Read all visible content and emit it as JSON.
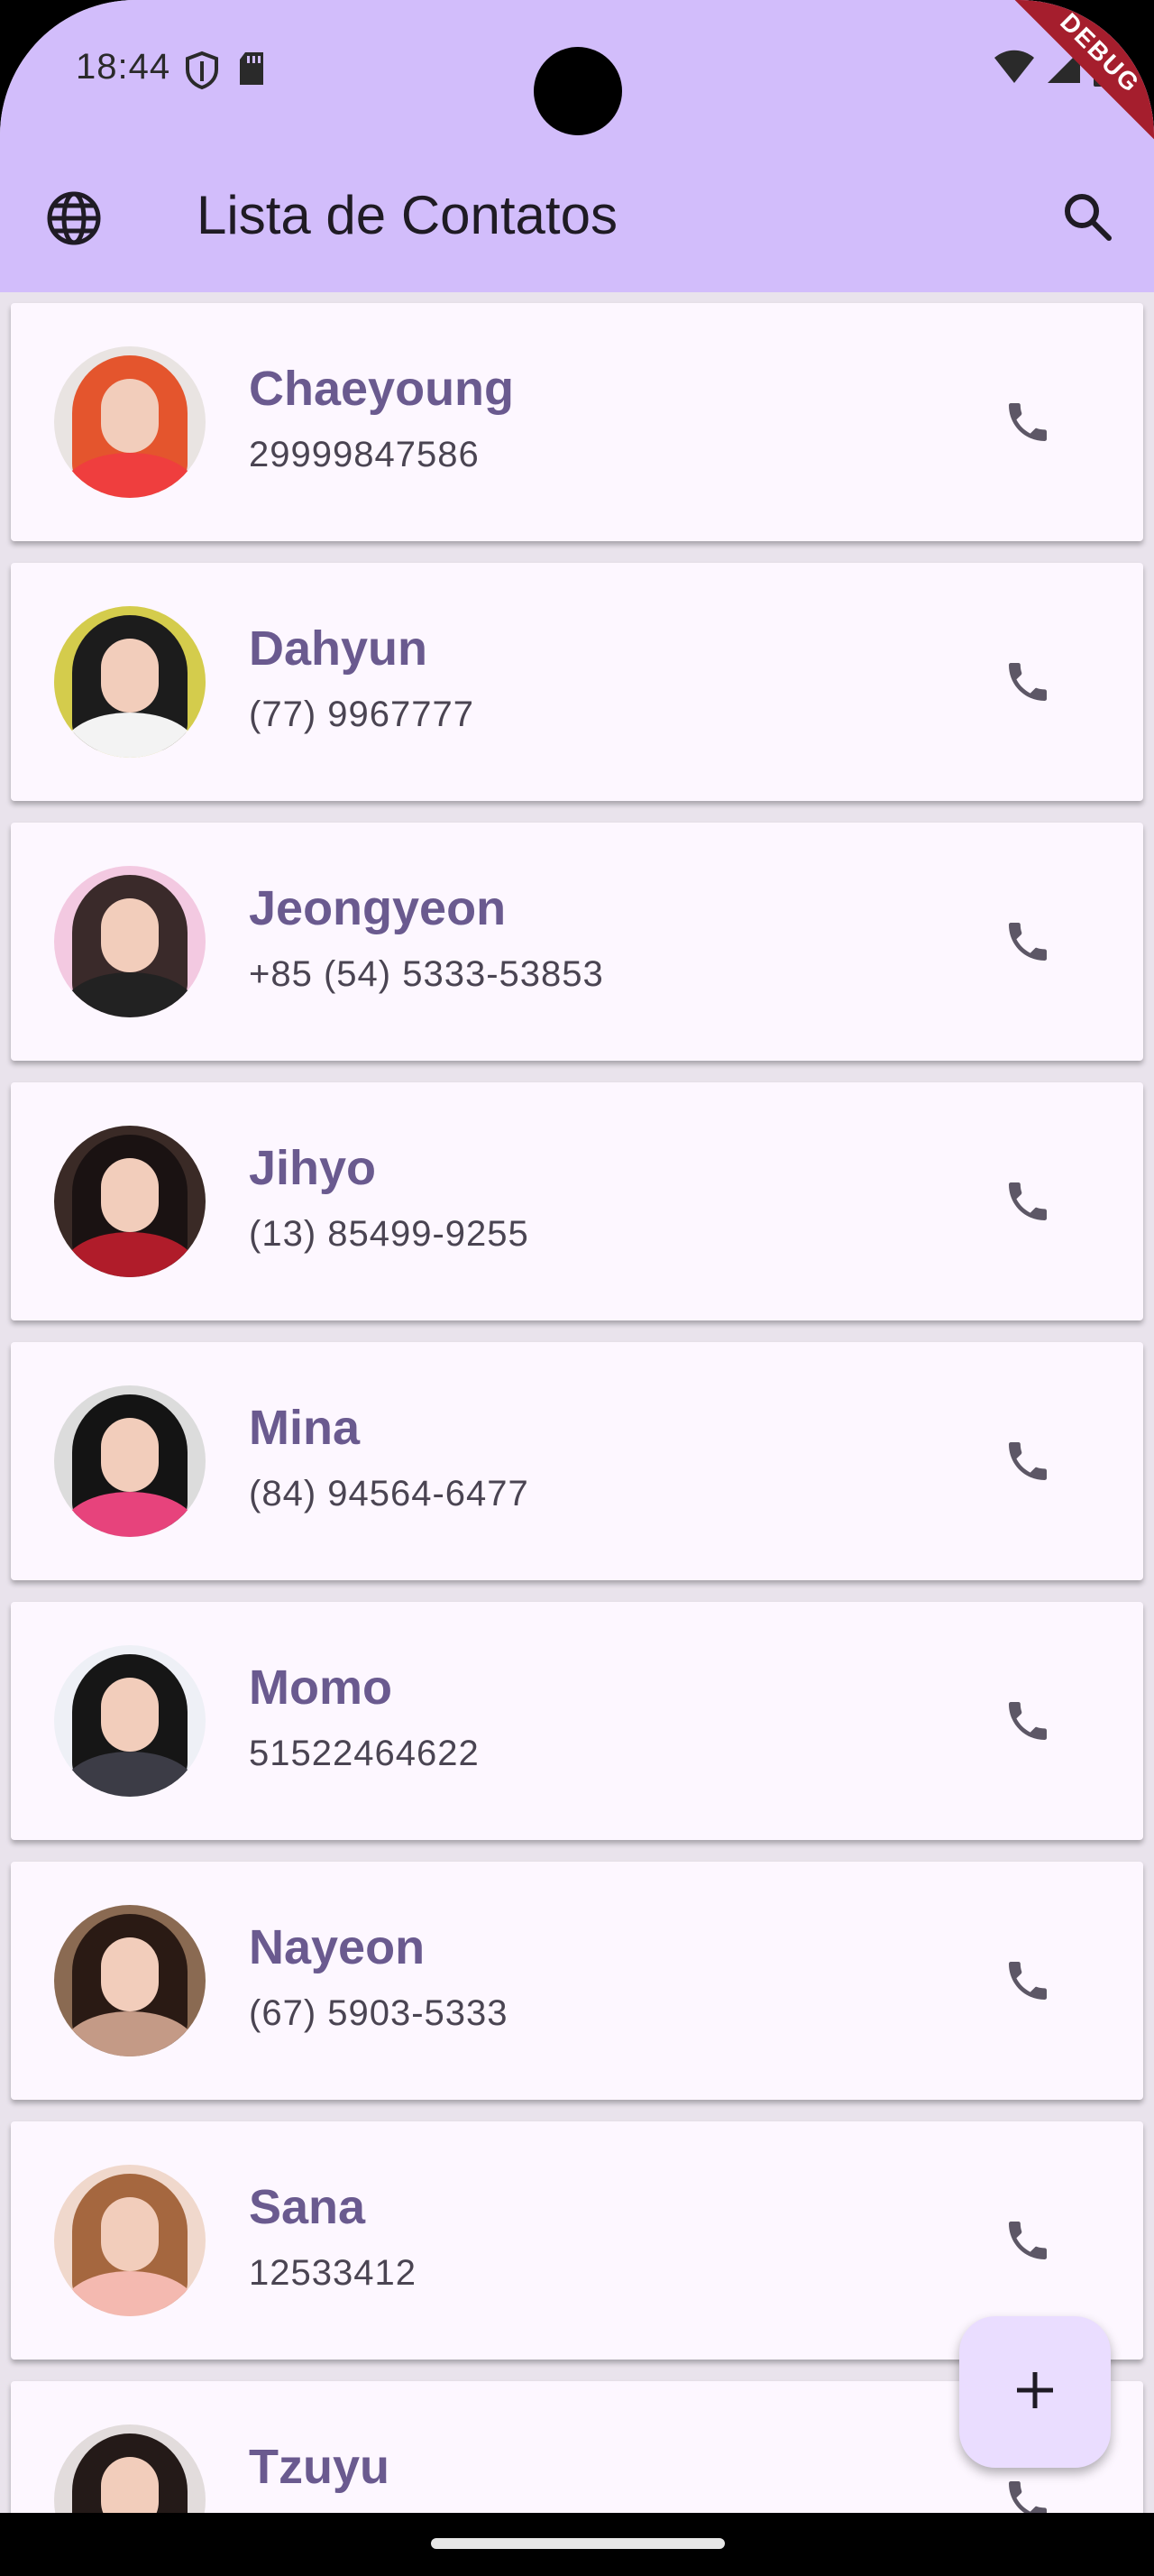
{
  "status_bar": {
    "time": "18:44",
    "left_icons": [
      "shield-icon",
      "sd-card-icon"
    ],
    "right_icons": [
      "wifi-icon",
      "signal-icon",
      "battery-icon"
    ],
    "debug_label": "DEBUG"
  },
  "app_bar": {
    "title": "Lista de Contatos",
    "leading_icon": "globe-icon",
    "trailing_icon": "search-icon",
    "color": "#d2bdfb"
  },
  "contacts": [
    {
      "name": "Chaeyoung",
      "phone": "29999847586"
    },
    {
      "name": "Dahyun",
      "phone": "(77) 9967777"
    },
    {
      "name": "Jeongyeon",
      "phone": "+85 (54) 5333-53853"
    },
    {
      "name": "Jihyo",
      "phone": "(13) 85499-9255"
    },
    {
      "name": "Mina",
      "phone": "(84) 94564-6477"
    },
    {
      "name": "Momo",
      "phone": "51522464622"
    },
    {
      "name": "Nayeon",
      "phone": "(67) 5903-5333"
    },
    {
      "name": "Sana",
      "phone": "12533412"
    },
    {
      "name": "Tzuyu",
      "phone": ""
    }
  ],
  "fab": {
    "icon": "plus-icon"
  },
  "colors": {
    "accent_name": "#6a5a8f",
    "card_bg": "#fdf7ff",
    "list_bg": "#e9e3ec",
    "fab_bg": "#eaddff"
  }
}
